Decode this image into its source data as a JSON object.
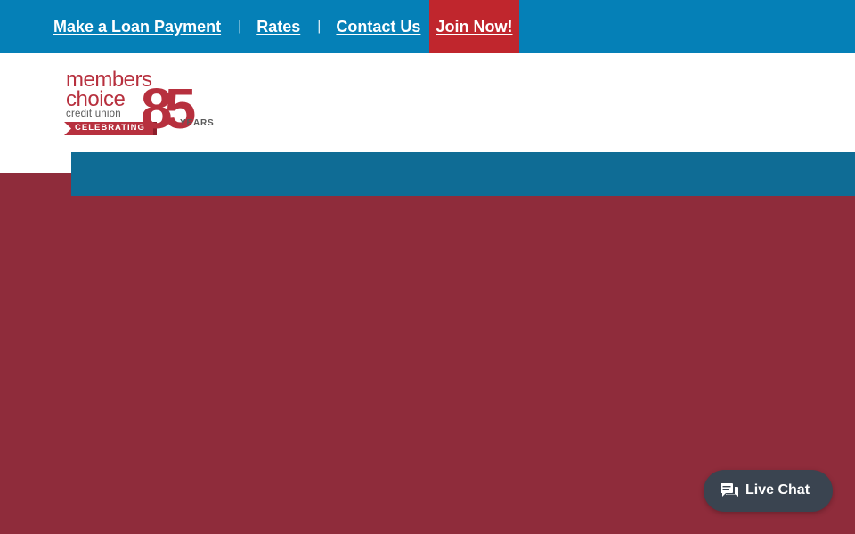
{
  "topbar": {
    "links": [
      {
        "label": "Make a Loan Payment"
      },
      {
        "label": "Rates"
      },
      {
        "label": "Contact Us"
      }
    ],
    "separator": "|",
    "join_label": "Join Now!"
  },
  "logo": {
    "line1": "members",
    "line2": "choice",
    "line3": "credit union",
    "banner": "CELEBRATING",
    "number": "85",
    "years": "YEARS"
  },
  "livechat": {
    "label": "Live Chat",
    "icon": "chat-bubbles-icon"
  },
  "colors": {
    "topbar": "#0580b7",
    "join": "#c0262d",
    "bluebar": "#0f6c95",
    "hero": "#8f2c3b",
    "brand_red": "#b7303e",
    "chat": "#3a4450"
  }
}
